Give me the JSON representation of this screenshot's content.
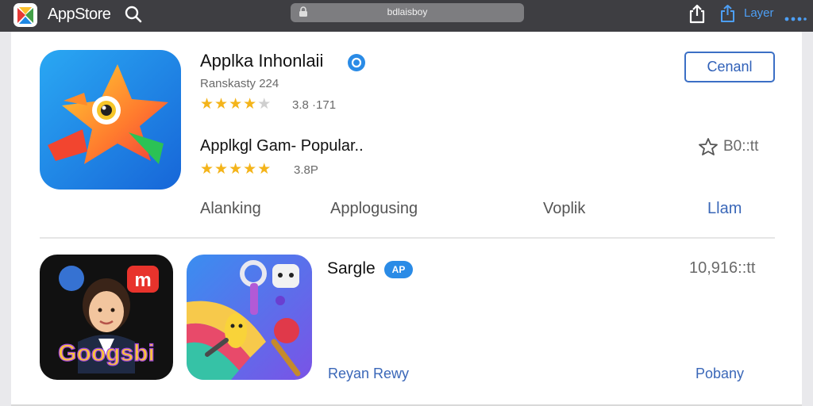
{
  "topbar": {
    "app_title": "AppStore",
    "url": "bdlaisboy",
    "layer_label": "Layer"
  },
  "featured": {
    "title": "Applka Inhonlaii",
    "developer": "Ranskasty 224",
    "rating_stars": 4,
    "rating_text": "3.8 ·171",
    "subtitle": "Applkgl Gam- Popular..",
    "rating2_stars": 5,
    "rating2_text": "3.8P",
    "open_button": "Cenanl",
    "price": "B0::tt"
  },
  "tabs": [
    {
      "label": "Alanking",
      "color": "#555555"
    },
    {
      "label": "Applogusing",
      "color": "#555555"
    },
    {
      "label": "Voplik",
      "color": "#555555"
    },
    {
      "label": "Llam",
      "color": "#3a67b8"
    }
  ],
  "second": {
    "title": "Sargle",
    "badge": "AP",
    "price": "10,916::tt",
    "icon_text": "Googsbi",
    "link_left": "Reyan Rewy",
    "link_right": "Pobany"
  },
  "icons": {
    "app_logo": "colorful-logo-icon",
    "search": "search-icon",
    "lock": "lock-icon",
    "share": "share-icon",
    "layer": "layer-icon",
    "more": "more-icon",
    "verified": "verified-badge-icon",
    "price_star": "star-outline-icon"
  },
  "colors": {
    "accent": "#3b6fc5",
    "badge": "#2a8be6",
    "star": "#f4b41a",
    "topbar": "#3e3e42"
  }
}
